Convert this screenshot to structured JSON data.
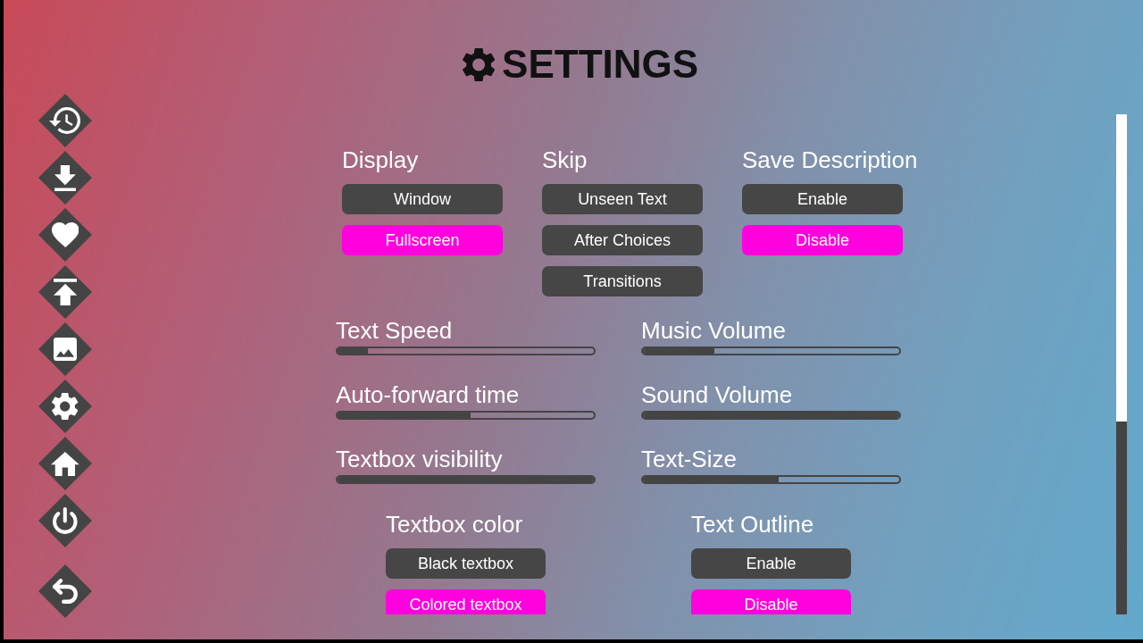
{
  "nav_buttons": [
    {
      "kind": "history"
    },
    {
      "kind": "download"
    },
    {
      "kind": "heart"
    },
    {
      "kind": "upload"
    },
    {
      "kind": "image"
    },
    {
      "kind": "gear"
    },
    {
      "kind": "home"
    },
    {
      "kind": "power"
    }
  ],
  "return_button": {
    "kind": "back"
  },
  "title": "SETTINGS",
  "option_groups": [
    {
      "heading": "Display",
      "options": [
        {
          "label": "Window",
          "selected": false
        },
        {
          "label": "Fullscreen",
          "selected": true
        }
      ]
    },
    {
      "heading": "Skip",
      "options": [
        {
          "label": "Unseen Text",
          "selected": false
        },
        {
          "label": "After Choices",
          "selected": false
        },
        {
          "label": "Transitions",
          "selected": false
        }
      ]
    },
    {
      "heading": "Save Description",
      "options": [
        {
          "label": "Enable",
          "selected": false
        },
        {
          "label": "Disable",
          "selected": true
        }
      ]
    }
  ],
  "sliders": [
    {
      "label": "Text Speed",
      "level": 0.12
    },
    {
      "label": "Music Volume",
      "level": 0.28
    },
    {
      "label": "Auto-forward time",
      "level": 0.52
    },
    {
      "label": "Sound Volume",
      "level": 1.0
    },
    {
      "label": "Textbox visibility",
      "level": 1.0
    },
    {
      "label": "Text-Size",
      "level": 0.53
    }
  ],
  "bottom_groups": [
    {
      "heading": "Textbox color",
      "options": [
        {
          "label": "Black textbox",
          "selected": false
        },
        {
          "label": "Colored textbox",
          "selected": true
        }
      ]
    },
    {
      "heading": "Text Outline",
      "options": [
        {
          "label": "Enable",
          "selected": false
        },
        {
          "label": "Disable",
          "selected": true
        }
      ]
    }
  ]
}
